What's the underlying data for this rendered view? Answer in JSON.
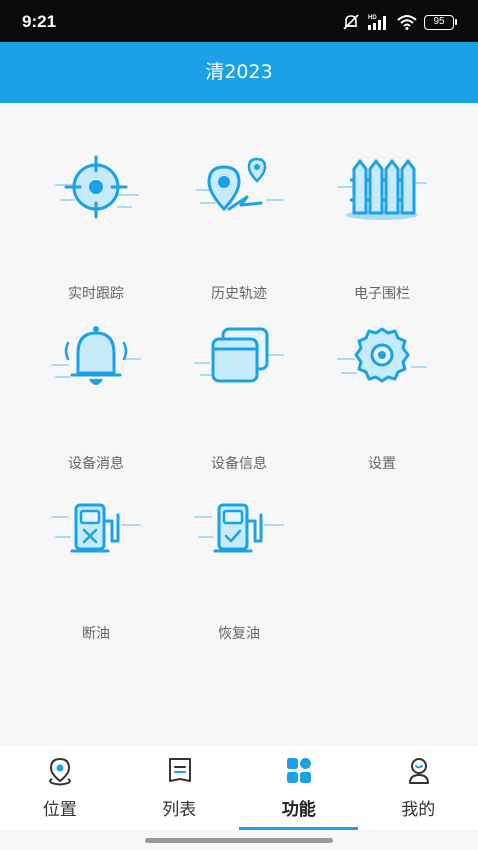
{
  "status_bar": {
    "time": "9:21",
    "battery": "95",
    "network_badge": "HD",
    "icons": [
      "bell-off-icon",
      "signal-icon",
      "wifi-icon",
      "battery-icon"
    ]
  },
  "app_bar": {
    "title": "清2023"
  },
  "functions": [
    {
      "label": "实时跟踪",
      "icon": "crosshair-target-icon"
    },
    {
      "label": "历史轨迹",
      "icon": "map-pin-route-icon"
    },
    {
      "label": "电子围栏",
      "icon": "fence-icon"
    },
    {
      "label": "设备消息",
      "icon": "bell-icon"
    },
    {
      "label": "设备信息",
      "icon": "device-cards-icon"
    },
    {
      "label": "设置",
      "icon": "gear-icon"
    },
    {
      "label": "断油",
      "icon": "fuel-pump-cut-icon"
    },
    {
      "label": "恢复油",
      "icon": "fuel-pump-restore-icon"
    }
  ],
  "bottom_nav": {
    "items": [
      {
        "label": "位置",
        "icon": "location-pin-icon"
      },
      {
        "label": "列表",
        "icon": "list-doc-icon"
      },
      {
        "label": "功能",
        "icon": "grid-apps-icon",
        "active": true
      },
      {
        "label": "我的",
        "icon": "profile-icon"
      }
    ]
  },
  "colors": {
    "primary": "#1aa1e8",
    "icon_light": "#a8dcf6",
    "label_gray": "#666666"
  }
}
